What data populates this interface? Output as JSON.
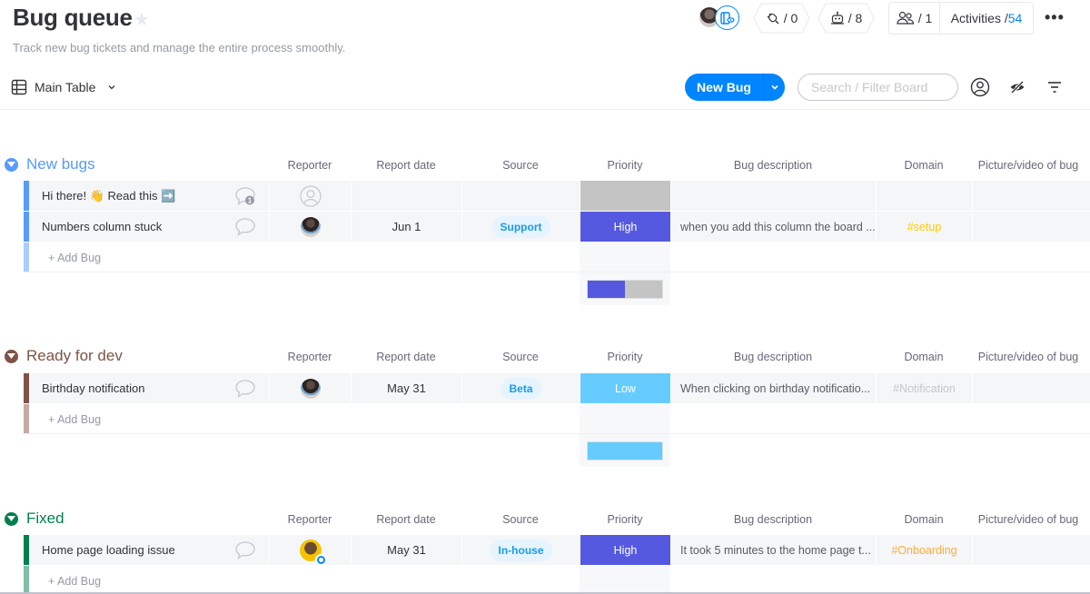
{
  "board": {
    "title": "Bug queue",
    "subtitle": "Track new bug tickets and manage the entire process smoothly.",
    "view_label": "Main Table"
  },
  "toolbar": {
    "integrations_count": "/ 0",
    "automations_count": "/ 8",
    "members_count": "/ 1",
    "activities_label": "Activities / ",
    "activities_count": "54",
    "more_label": "•••",
    "new_item_label": "New Bug",
    "search_placeholder": "Search / Filter Board"
  },
  "columns": [
    "Reporter",
    "Report date",
    "Source",
    "Priority",
    "Bug description",
    "Domain",
    "Picture/video of bug"
  ],
  "colors": {
    "new_bugs": "#579bfc",
    "ready_for_dev": "#7f5347",
    "fixed": "#037f4c",
    "priority_high": "#5559df",
    "priority_low": "#66ccff",
    "priority_empty": "#c4c4c4",
    "domain_setup": "#ffcb00",
    "domain_notification": "#c5c7d0",
    "domain_onboarding": "#fdab3d",
    "accent": "#0085ff"
  },
  "groups": [
    {
      "title": "New bugs",
      "add_label": "+ Add Bug",
      "items": [
        {
          "name": "Hi there! 👋 Read this ➡️",
          "reporter": "empty",
          "date": "",
          "source": "",
          "priority": "",
          "description": "",
          "domain": "",
          "comments": "1"
        },
        {
          "name": "Numbers column stuck",
          "reporter": "photo",
          "date": "Jun 1",
          "source": "Support",
          "priority": "High",
          "description": "when you add this column the board ...",
          "domain": "#setup",
          "comments": ""
        }
      ],
      "priority_summary": {
        "High": 0.5,
        "Empty": 0.5
      }
    },
    {
      "title": "Ready for dev",
      "add_label": "+ Add Bug",
      "items": [
        {
          "name": "Birthday notification",
          "reporter": "photo",
          "date": "May 31",
          "source": "Beta",
          "priority": "Low",
          "description": "When clicking on birthday notificatio...",
          "domain": "#Notification",
          "comments": ""
        }
      ],
      "priority_summary": {
        "Low": 1.0
      }
    },
    {
      "title": "Fixed",
      "add_label": "+ Add Bug",
      "items": [
        {
          "name": "Home page loading issue",
          "reporter": "photo-yellow",
          "date": "May 31",
          "source": "In-house",
          "priority": "High",
          "description": "It took 5 minutes to the home page t...",
          "domain": "#Onboarding",
          "comments": ""
        }
      ]
    }
  ]
}
